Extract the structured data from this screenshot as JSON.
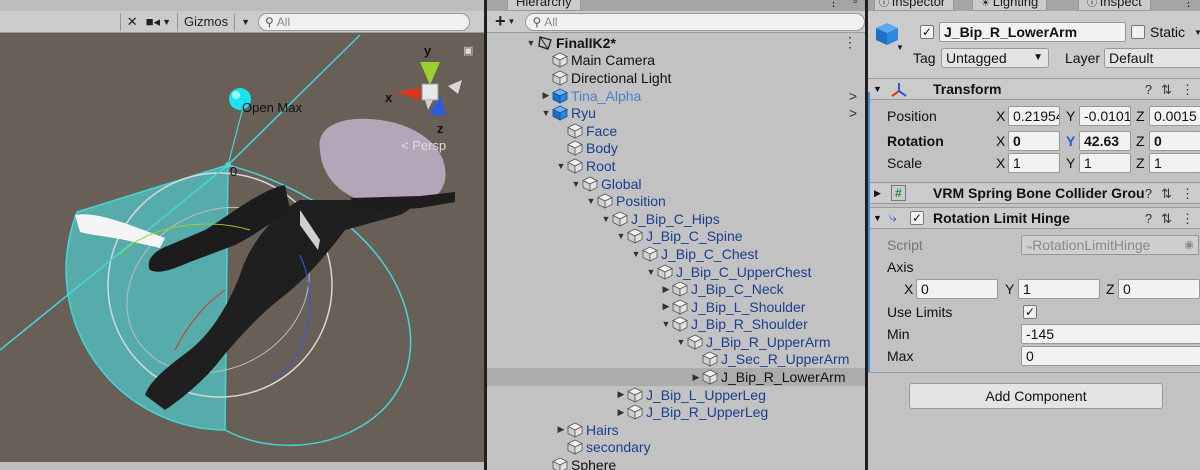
{
  "scene": {
    "toolbar": {
      "gizmos_label": "Gizmos",
      "search_placeholder": "All"
    },
    "handle_label": "Open Max",
    "angle_label": "0",
    "persp_label": "< Persp",
    "axes": {
      "x": "x",
      "y": "y",
      "z": "z"
    }
  },
  "hierarchy": {
    "tab_label": "Hierarchy",
    "add_label": "+",
    "search_placeholder": "All",
    "items": [
      {
        "label": "FinalIK2*",
        "depth": 0,
        "fold": "open",
        "style": "black",
        "icon": "unity-scene-icon",
        "menu": "⋮"
      },
      {
        "label": "Main Camera",
        "depth": 1,
        "fold": "none",
        "style": "black",
        "icon": "gameobject-cube-icon"
      },
      {
        "label": "Directional Light",
        "depth": 1,
        "fold": "none",
        "style": "black",
        "icon": "gameobject-cube-icon"
      },
      {
        "label": "Tina_Alpha",
        "depth": 1,
        "fold": "closed",
        "style": "prefab",
        "icon": "prefab-cube-icon",
        "arrow": ">"
      },
      {
        "label": "Ryu",
        "depth": 1,
        "fold": "open",
        "style": "blue",
        "icon": "prefab-cube-icon",
        "arrow": ">"
      },
      {
        "label": "Face",
        "depth": 2,
        "fold": "none",
        "style": "blue",
        "icon": "gameobject-cube-icon"
      },
      {
        "label": "Body",
        "depth": 2,
        "fold": "none",
        "style": "blue",
        "icon": "gameobject-cube-icon"
      },
      {
        "label": "Root",
        "depth": 2,
        "fold": "open",
        "style": "blue",
        "icon": "gameobject-cube-icon"
      },
      {
        "label": "Global",
        "depth": 3,
        "fold": "open",
        "style": "blue",
        "icon": "gameobject-cube-icon"
      },
      {
        "label": "Position",
        "depth": 4,
        "fold": "open",
        "style": "blue",
        "icon": "gameobject-cube-icon"
      },
      {
        "label": "J_Bip_C_Hips",
        "depth": 5,
        "fold": "open",
        "style": "blue",
        "icon": "gameobject-cube-icon"
      },
      {
        "label": "J_Bip_C_Spine",
        "depth": 6,
        "fold": "open",
        "style": "blue",
        "icon": "gameobject-cube-icon"
      },
      {
        "label": "J_Bip_C_Chest",
        "depth": 7,
        "fold": "open",
        "style": "blue",
        "icon": "gameobject-cube-icon"
      },
      {
        "label": "J_Bip_C_UpperChest",
        "depth": 8,
        "fold": "open",
        "style": "blue",
        "icon": "gameobject-cube-icon"
      },
      {
        "label": "J_Bip_C_Neck",
        "depth": 9,
        "fold": "closed",
        "style": "blue",
        "icon": "gameobject-cube-icon"
      },
      {
        "label": "J_Bip_L_Shoulder",
        "depth": 9,
        "fold": "closed",
        "style": "blue",
        "icon": "gameobject-cube-icon"
      },
      {
        "label": "J_Bip_R_Shoulder",
        "depth": 9,
        "fold": "open",
        "style": "blue",
        "icon": "gameobject-cube-icon"
      },
      {
        "label": "J_Bip_R_UpperArm",
        "depth": 10,
        "fold": "open",
        "style": "blue",
        "icon": "gameobject-cube-icon"
      },
      {
        "label": "J_Sec_R_UpperArm",
        "depth": 11,
        "fold": "none",
        "style": "blue",
        "icon": "gameobject-cube-icon"
      },
      {
        "label": "J_Bip_R_LowerArm",
        "depth": 11,
        "fold": "closed",
        "style": "black",
        "icon": "gameobject-cube-icon",
        "selected": true
      },
      {
        "label": "J_Bip_L_UpperLeg",
        "depth": 6,
        "fold": "closed",
        "style": "blue",
        "icon": "gameobject-cube-icon"
      },
      {
        "label": "J_Bip_R_UpperLeg",
        "depth": 6,
        "fold": "closed",
        "style": "blue",
        "icon": "gameobject-cube-icon"
      },
      {
        "label": "Hairs",
        "depth": 2,
        "fold": "closed",
        "style": "blue",
        "icon": "gameobject-cube-icon"
      },
      {
        "label": "secondary",
        "depth": 2,
        "fold": "none",
        "style": "blue",
        "icon": "gameobject-cube-icon"
      },
      {
        "label": "Sphere",
        "depth": 1,
        "fold": "none",
        "style": "black",
        "icon": "gameobject-cube-icon"
      }
    ]
  },
  "inspector": {
    "tabs": [
      "Inspector",
      "Lighting",
      "Inspect"
    ],
    "object_name": "J_Bip_R_LowerArm",
    "active_checked": true,
    "static_label": "Static",
    "tag_label": "Tag",
    "tag_value": "Untagged",
    "layer_label": "Layer",
    "layer_value": "Default",
    "transform": {
      "title": "Transform",
      "position_label": "Position",
      "rotation_label": "Rotation",
      "scale_label": "Scale",
      "position": {
        "x": "0.21954",
        "y": "-0.0101",
        "z": "0.0015"
      },
      "rotation": {
        "x": "0",
        "y": "42.63",
        "z": "0"
      },
      "scale": {
        "x": "1",
        "y": "1",
        "z": "1"
      }
    },
    "spring_bone": {
      "title": "VRM Spring Bone Collider Grou"
    },
    "hinge": {
      "title": "Rotation Limit Hinge",
      "enabled": true,
      "script_label": "Script",
      "script_value": "RotationLimitHinge",
      "axis_label": "Axis",
      "axis": {
        "x": "0",
        "y": "1",
        "z": "0"
      },
      "use_limits_label": "Use Limits",
      "use_limits": true,
      "min_label": "Min",
      "min_value": "-145",
      "max_label": "Max",
      "max_value": "0"
    },
    "add_component_label": "Add Component"
  },
  "colors": {
    "scene_bg": "#686058",
    "panel_bg": "#c2c2c2",
    "selection": "#acacac",
    "hierarchy_blue": "#1a3f8f",
    "gizmo_cyan": "#45d6d6",
    "axis_x": "#e0341a",
    "axis_y": "#9bd12a",
    "axis_z": "#2a5be0"
  }
}
